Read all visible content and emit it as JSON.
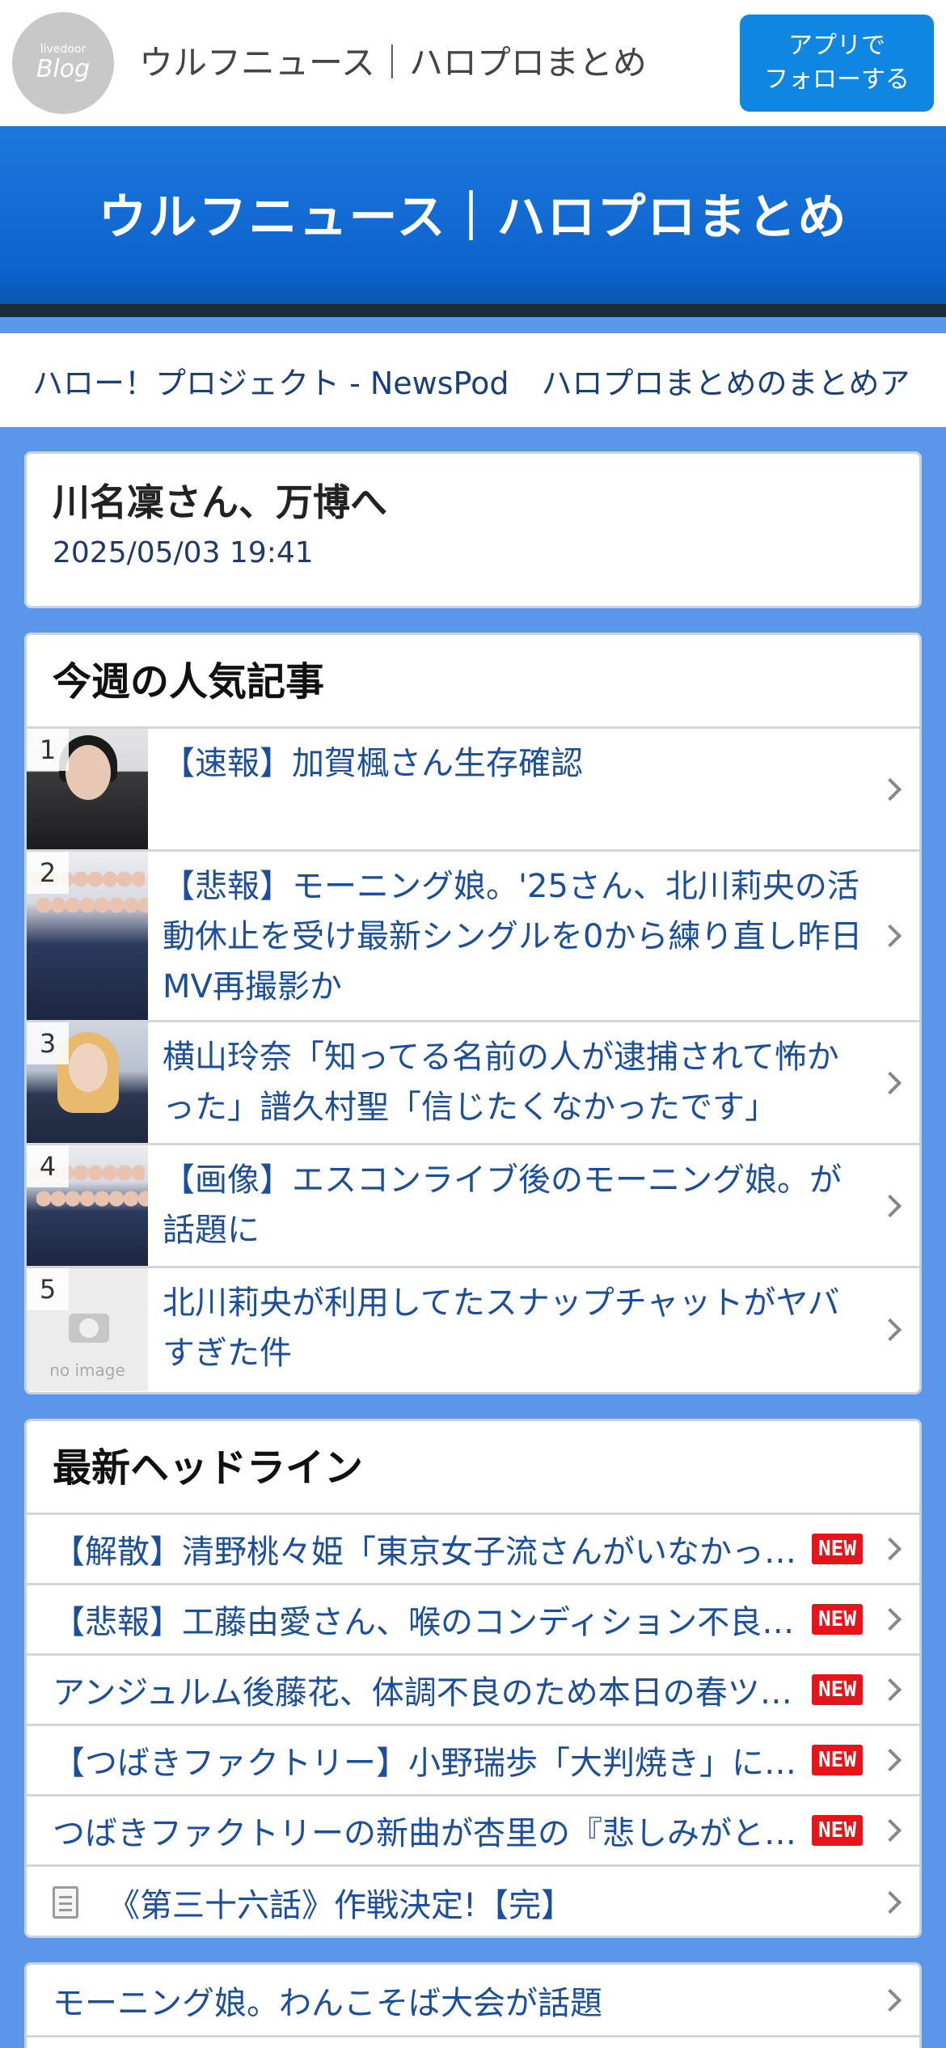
{
  "appbar": {
    "logo_small": "livedoor",
    "logo_big": "Blog",
    "title": "ウルフニュース｜ハロプロまとめ",
    "follow_line1": "アプリで",
    "follow_line2": "フォローする"
  },
  "banner": {
    "title": "ウルフニュース｜ハロプロまとめ"
  },
  "linkstrip": {
    "links": [
      "ハロー！プロジェクト - NewsPod",
      "ハロプロまとめのまとめア"
    ]
  },
  "article": {
    "title": "川名凜さん、万博へ",
    "date": "2025/05/03 19:41"
  },
  "popular": {
    "heading": "今週の人気記事",
    "items": [
      {
        "rank": "1",
        "text": "【速報】加賀楓さん生存確認",
        "thumb": "portrait"
      },
      {
        "rank": "2",
        "text": "【悲報】モーニング娘。'25さん、北川莉央の活動休止を受け最新シングルを0から練り直し昨日MV再撮影か",
        "thumb": "group"
      },
      {
        "rank": "3",
        "text": "横山玲奈「知ってる名前の人が逮捕されて怖かった」譜久村聖「信じたくなかったです」",
        "thumb": "blonde"
      },
      {
        "rank": "4",
        "text": "【画像】エスコンライブ後のモーニング娘。が話題に",
        "thumb": "group"
      },
      {
        "rank": "5",
        "text": "北川莉央が利用してたスナップチャットがヤバすぎた件",
        "thumb": "none"
      }
    ],
    "noimage_label": "no image"
  },
  "headlines": {
    "heading": "最新ヘッドライン",
    "new_label": "NEW",
    "items": [
      {
        "text": "【解散】清野桃々姫「東京女子流さんがいなかったら今の私はいない」",
        "is_new": true
      },
      {
        "text": "【悲報】工藤由愛さん、喉のコンディション不良のため",
        "is_new": true
      },
      {
        "text": "アンジュルム後藤花、体調不良のため本日の春ツアー公演を欠席",
        "is_new": true
      },
      {
        "text": "【つばきファクトリー】小野瑞歩「大判焼き」について",
        "is_new": true
      },
      {
        "text": "つばきファクトリーの新曲が杏里の『悲しみがとまらない』",
        "is_new": true
      },
      {
        "text": "《第三十六話》作戦決定!【完】",
        "is_new": false
      }
    ]
  },
  "bottom": {
    "items": [
      {
        "text": "モーニング娘。わんこそば大会が話題"
      }
    ]
  },
  "colors": {
    "page_background": "#5b96ea",
    "banner": "#0d63cc",
    "follow_button": "#0f86e2",
    "link_text": "#1b4f9c",
    "new_badge": "#e8141b"
  },
  "icons": {
    "chevron": "chevron-right-icon",
    "document": "document-icon",
    "camera": "camera-icon"
  }
}
